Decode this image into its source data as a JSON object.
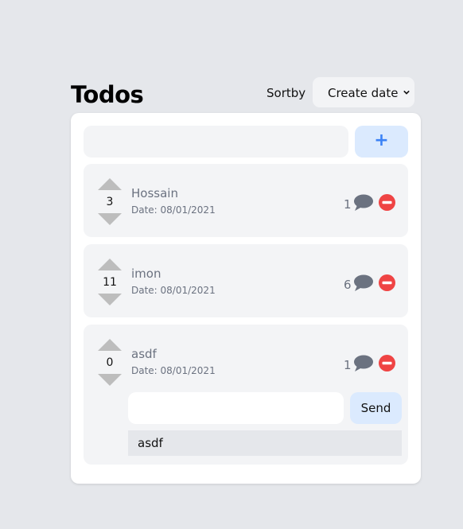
{
  "header": {
    "title": "Todos",
    "sort_label": "Sortby",
    "sort_selected": "Create date"
  },
  "new_todo": {
    "value": "",
    "add_label": "+"
  },
  "todos": [
    {
      "text": "Hossain",
      "date": "Date: 08/01/2021",
      "votes": "3",
      "comments": "1"
    },
    {
      "text": "imon",
      "date": "Date: 08/01/2021",
      "votes": "11",
      "comments": "6"
    },
    {
      "text": "asdf",
      "date": "Date: 08/01/2021",
      "votes": "0",
      "comments": "1"
    }
  ],
  "comment_panel": {
    "input_value": "",
    "send_label": "Send",
    "comments": [
      "asdf"
    ]
  },
  "colors": {
    "background": "#e5e7eb",
    "card": "#ffffff",
    "item_bg": "#f3f4f6",
    "accent_blue": "#3b82f6",
    "button_bg": "#dbeafe",
    "delete_red": "#ef4444",
    "vote_gray": "#bdbdbd"
  },
  "icons": [
    "chevron-down-icon",
    "upvote-icon",
    "downvote-icon",
    "comment-icon",
    "delete-icon"
  ]
}
